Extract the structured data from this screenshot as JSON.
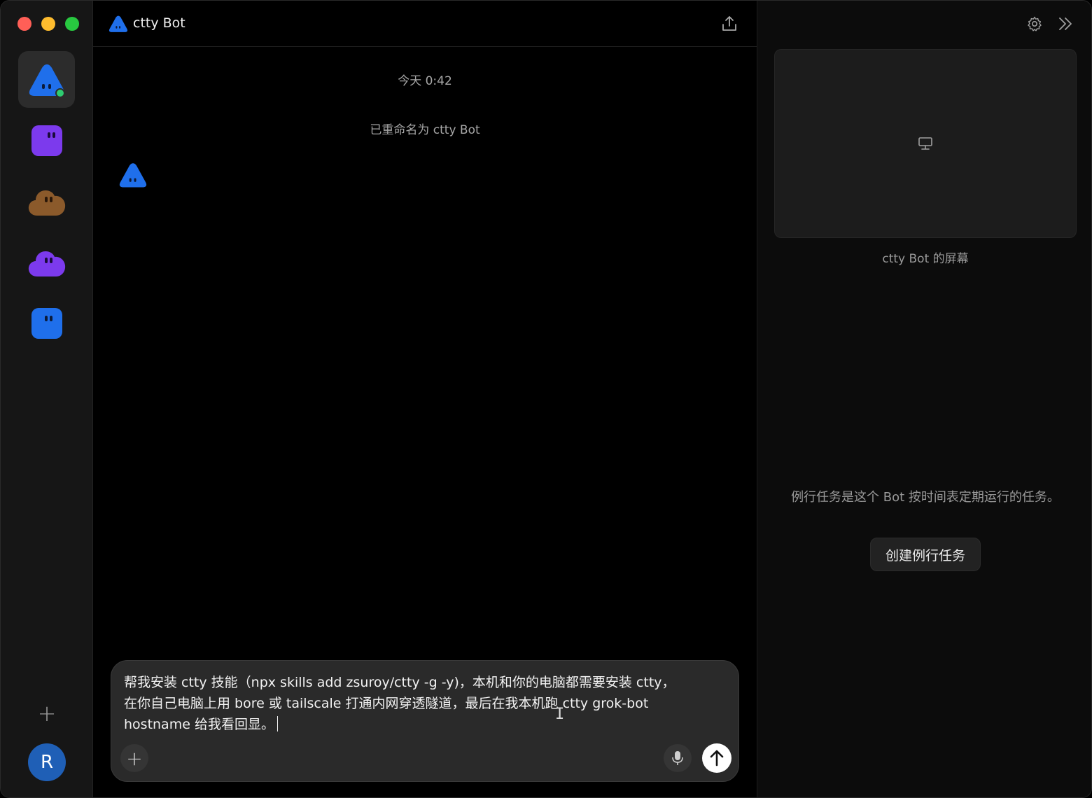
{
  "window": {
    "traffic_lights": [
      "close",
      "minimize",
      "zoom"
    ],
    "colors": {
      "close": "#ff5f57",
      "minimize": "#febc2e",
      "zoom": "#28c840"
    }
  },
  "sidebar": {
    "bots": [
      {
        "id": "ctty-bot",
        "shape": "triangle",
        "color": "#1f6feb",
        "active": true,
        "online": true
      },
      {
        "id": "bot-2",
        "shape": "square",
        "color": "#7c3aed",
        "active": false,
        "online": false
      },
      {
        "id": "bot-3",
        "shape": "cloud",
        "color": "#8b5a2b",
        "active": false,
        "online": false
      },
      {
        "id": "bot-4",
        "shape": "cloud",
        "color": "#7c3aed",
        "active": false,
        "online": false
      },
      {
        "id": "bot-5",
        "shape": "square",
        "color": "#1f6feb",
        "active": false,
        "online": false
      }
    ],
    "add_icon": "+",
    "user_initial": "R"
  },
  "header": {
    "title": "ctty Bot",
    "share_icon": "share-icon"
  },
  "chat": {
    "timestamp": "今天 0:42",
    "system_note": "已重命名为 ctty Bot"
  },
  "composer": {
    "text": "帮我安装 ctty 技能（npx skills add zsuroy/ctty -g -y)，本机和你的电脑都需要安装 ctty，\n在你自己电脑上用 bore 或 tailscale 打通内网穿透隧道，最后在我本机跑 ctty grok-bot\nhostname 给我看回显。",
    "add_icon": "+",
    "mic_icon": "mic-icon",
    "send_icon": "arrow-up-icon"
  },
  "right_panel": {
    "screen_caption": "ctty Bot 的屏幕",
    "routine_description": "例行任务是这个 Bot 按时间表定期运行的任务。",
    "routine_button": "创建例行任务"
  }
}
